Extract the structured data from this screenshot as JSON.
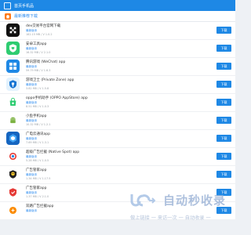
{
  "header": {
    "title": "首页手机品"
  },
  "section": {
    "label": "最新推荐下载"
  },
  "apps": [
    {
      "name": "dev交易平台官网下载",
      "tag": "最新版本",
      "meta": "182.15 MB / V 1.0.2",
      "download": "下载",
      "icon": "cube-icon",
      "bg": "#111111"
    },
    {
      "name": "安卓工具app",
      "tag": "最新版本",
      "meta": "16.32 MB / V 2.1.0",
      "download": "下载",
      "icon": "shield-heart-icon",
      "bg": "#2ecc71"
    },
    {
      "name": "腾讯游戏 (WeChat) app",
      "tag": "最新版本",
      "meta": "59.79 MB / V 1.6.3",
      "download": "下载",
      "icon": "grid-icon",
      "bg": "#1e88e5"
    },
    {
      "name": "游戏卫士 (Private Zone) app",
      "tag": "最新版本",
      "meta": "3.82 MB / V 1.5.8",
      "download": "下载",
      "icon": "shield-icon",
      "bg": "#e3f2fd"
    },
    {
      "name": "oppo手机助手 (OPPO AppStore) app",
      "tag": "最新版本",
      "meta": "8.51 MB / V 1.0.3",
      "download": "下载",
      "icon": "bag-icon",
      "bg": "#ffffff"
    },
    {
      "name": "小鱼手机app",
      "tag": "最新版本",
      "meta": "10.32 MB / V 1.2.1",
      "download": "下载",
      "icon": "android-icon",
      "bg": "#ffffff"
    },
    {
      "name": "广电云通讯app",
      "tag": "最新版本",
      "meta": "7.69 MB / V 1.3.1",
      "download": "下载",
      "icon": "hexagon-icon",
      "bg": "#1565c0"
    },
    {
      "name": "超级广告拦截 (Native Spot) app",
      "tag": "最新版本",
      "meta": "5.28 MB / V 1.0.5",
      "download": "下载",
      "icon": "target-icon",
      "bg": "#ffffff"
    },
    {
      "name": "广告管家app",
      "tag": "最新版本",
      "meta": "1.34 MB / V 1.17.5",
      "download": "下载",
      "icon": "skull-icon",
      "bg": "#ffffff"
    },
    {
      "name": "广告管家app",
      "tag": "最新版本",
      "meta": "1.37 MB / V 2.1.0",
      "download": "下载",
      "icon": "shield-red-icon",
      "bg": "#ffffff"
    },
    {
      "name": "双路广告拦截app",
      "tag": "最新版本",
      "meta": "",
      "download": "下载",
      "icon": "circle-icon",
      "bg": "#ffffff"
    }
  ],
  "watermark": {
    "brand": "自动秒收录",
    "tagline": "做上链接 一 来访一次 一 自动收录 一"
  }
}
